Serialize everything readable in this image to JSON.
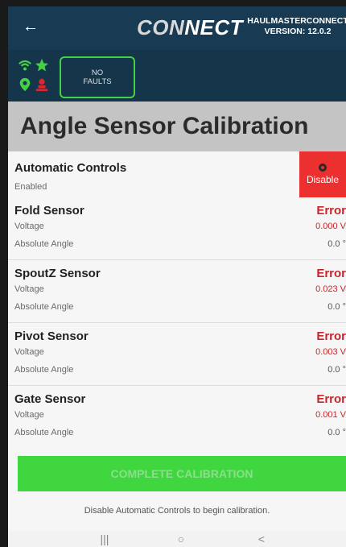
{
  "header": {
    "back_label": "←",
    "logo": {
      "part1": "CON",
      "part2": "NECT"
    },
    "app_name": "HAULMASTERCONNECT",
    "version": "VERSION: 12.0.2"
  },
  "status": {
    "icons": [
      "wifi-icon",
      "star-icon",
      "location-pin-icon",
      "operator-icon"
    ],
    "faults_line1": "NO",
    "faults_line2": "FAULTS",
    "colors": {
      "green": "#45d145",
      "red": "#d9282f",
      "header": "#183a52"
    }
  },
  "page": {
    "title": "Angle Sensor Calibration"
  },
  "automatic_controls": {
    "label": "Automatic Controls",
    "status": "Enabled",
    "button_label": "Disable"
  },
  "sensors": [
    {
      "name": "Fold Sensor",
      "state": "Error",
      "voltage_label": "Voltage",
      "voltage": "0.000 V",
      "angle_label": "Absolute Angle",
      "angle": "0.0 °"
    },
    {
      "name": "SpoutZ Sensor",
      "state": "Error",
      "voltage_label": "Voltage",
      "voltage": "0.023 V",
      "angle_label": "Absolute Angle",
      "angle": "0.0 °"
    },
    {
      "name": "Pivot Sensor",
      "state": "Error",
      "voltage_label": "Voltage",
      "voltage": "0.003 V",
      "angle_label": "Absolute Angle",
      "angle": "0.0 °"
    },
    {
      "name": "Gate Sensor",
      "state": "Error",
      "voltage_label": "Voltage",
      "voltage": "0.001 V",
      "angle_label": "Absolute Angle",
      "angle": "0.0 °"
    }
  ],
  "actions": {
    "complete_label": "COMPLETE CALIBRATION",
    "hint": "Disable Automatic Controls to begin calibration."
  },
  "navbar": {
    "recents": "|||",
    "home": "○",
    "back": "<"
  }
}
